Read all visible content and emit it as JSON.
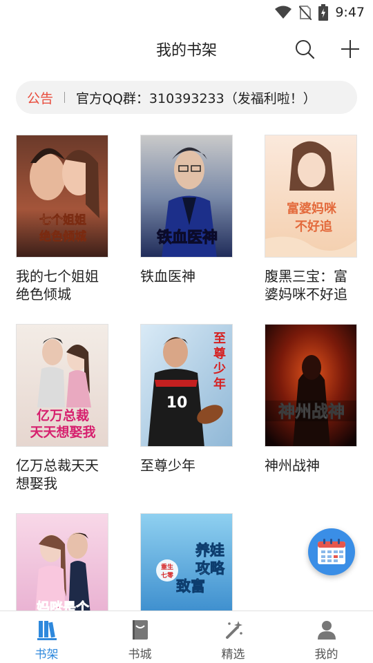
{
  "status_bar": {
    "time": "9:47"
  },
  "header": {
    "title": "我的书架"
  },
  "notice": {
    "tag": "公告",
    "message": "官方QQ群：310393233（发福利啦！）"
  },
  "books": [
    {
      "title": "我的七个姐姐绝色倾城",
      "cover_text": "我的七个姐姐绝色倾城"
    },
    {
      "title": "铁血医神",
      "cover_text": "铁血医神"
    },
    {
      "title": "腹黑三宝：富婆妈咪不好追",
      "cover_text": "富婆妈咪不好追"
    },
    {
      "title": "亿万总裁天天想娶我",
      "cover_text": "亿万总裁天天想娶我"
    },
    {
      "title": "至尊少年",
      "cover_text": "至尊少年"
    },
    {
      "title": "神州战神",
      "cover_text": "神州战神"
    },
    {
      "title": "",
      "cover_text": "妈咪是个"
    },
    {
      "title": "",
      "cover_text": "养娃攻略致富"
    }
  ],
  "tabs": [
    {
      "label": "书架",
      "icon": "bookshelf-icon",
      "active": true
    },
    {
      "label": "书城",
      "icon": "bookstore-icon",
      "active": false
    },
    {
      "label": "精选",
      "icon": "magic-wand-icon",
      "active": false
    },
    {
      "label": "我的",
      "icon": "profile-icon",
      "active": false
    }
  ],
  "colors": {
    "accent": "#2e88dc",
    "notice_tag": "#e84c3d",
    "fab": "#3a8ee6"
  }
}
